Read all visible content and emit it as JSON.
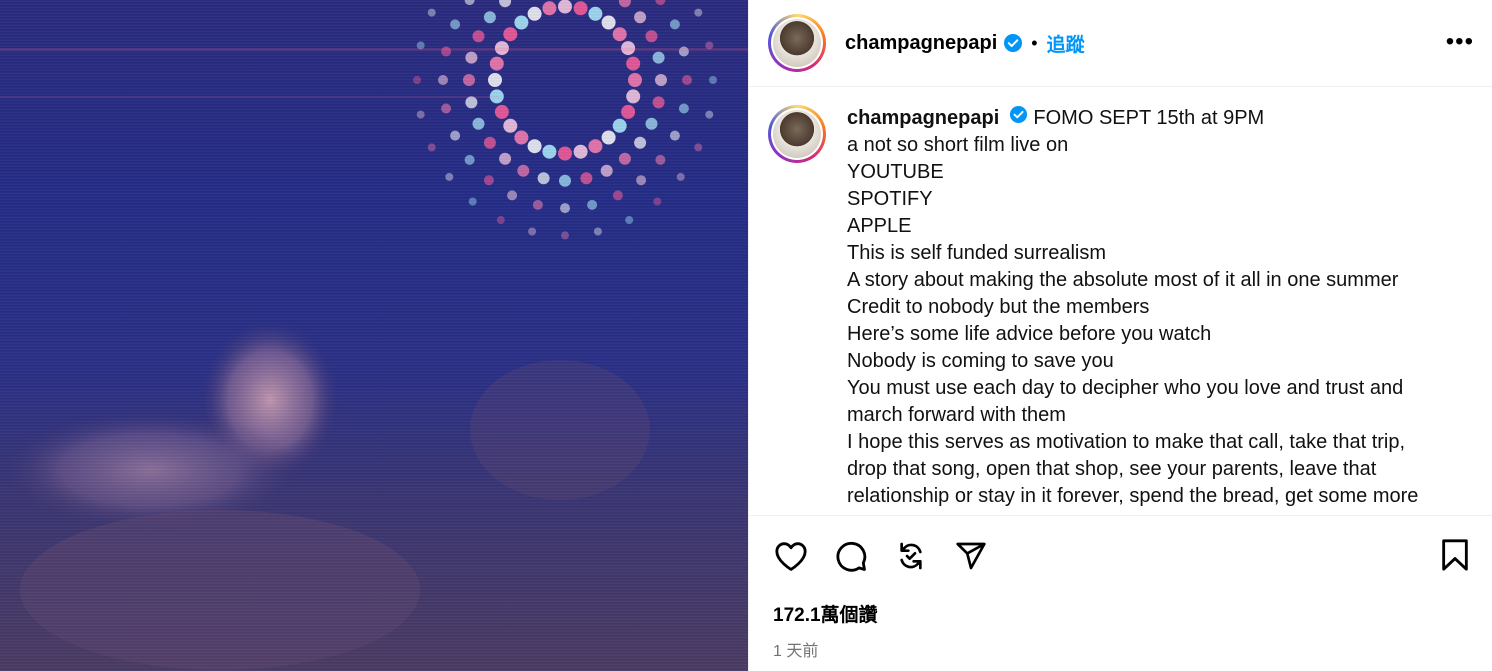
{
  "post": {
    "username": "champagnepapi",
    "follow_label": "追蹤",
    "separator": "•",
    "more_label": "•••"
  },
  "caption": {
    "username": "champagnepapi",
    "lines": [
      "FOMO SEPT 15th at 9PM",
      "a not so short film live on",
      "YOUTUBE",
      "SPOTIFY",
      "APPLE",
      "This is self funded surrealism",
      "A story about making the absolute most of it all in one summer",
      "Credit to nobody but the members",
      "Here’s some life advice before you watch",
      "Nobody is coming to save you",
      "You must use each day to decipher who you love and trust and",
      "march forward with them",
      "I hope this serves as motivation to make that call, take that trip,",
      "drop that song, open that shop, see your parents, leave that",
      "relationship or stay in it forever, spend the bread, get some more"
    ]
  },
  "engagement": {
    "likes": "172.1萬個讚",
    "time_ago": "1 天前"
  },
  "icons": {
    "like": "heart-icon",
    "comment": "comment-icon",
    "repost": "repost-icon",
    "share": "share-icon",
    "save": "bookmark-icon",
    "verified": "verified-badge-icon"
  },
  "colors": {
    "follow": "#0095f6",
    "verified": "#0095f6",
    "muted": "#737373"
  }
}
